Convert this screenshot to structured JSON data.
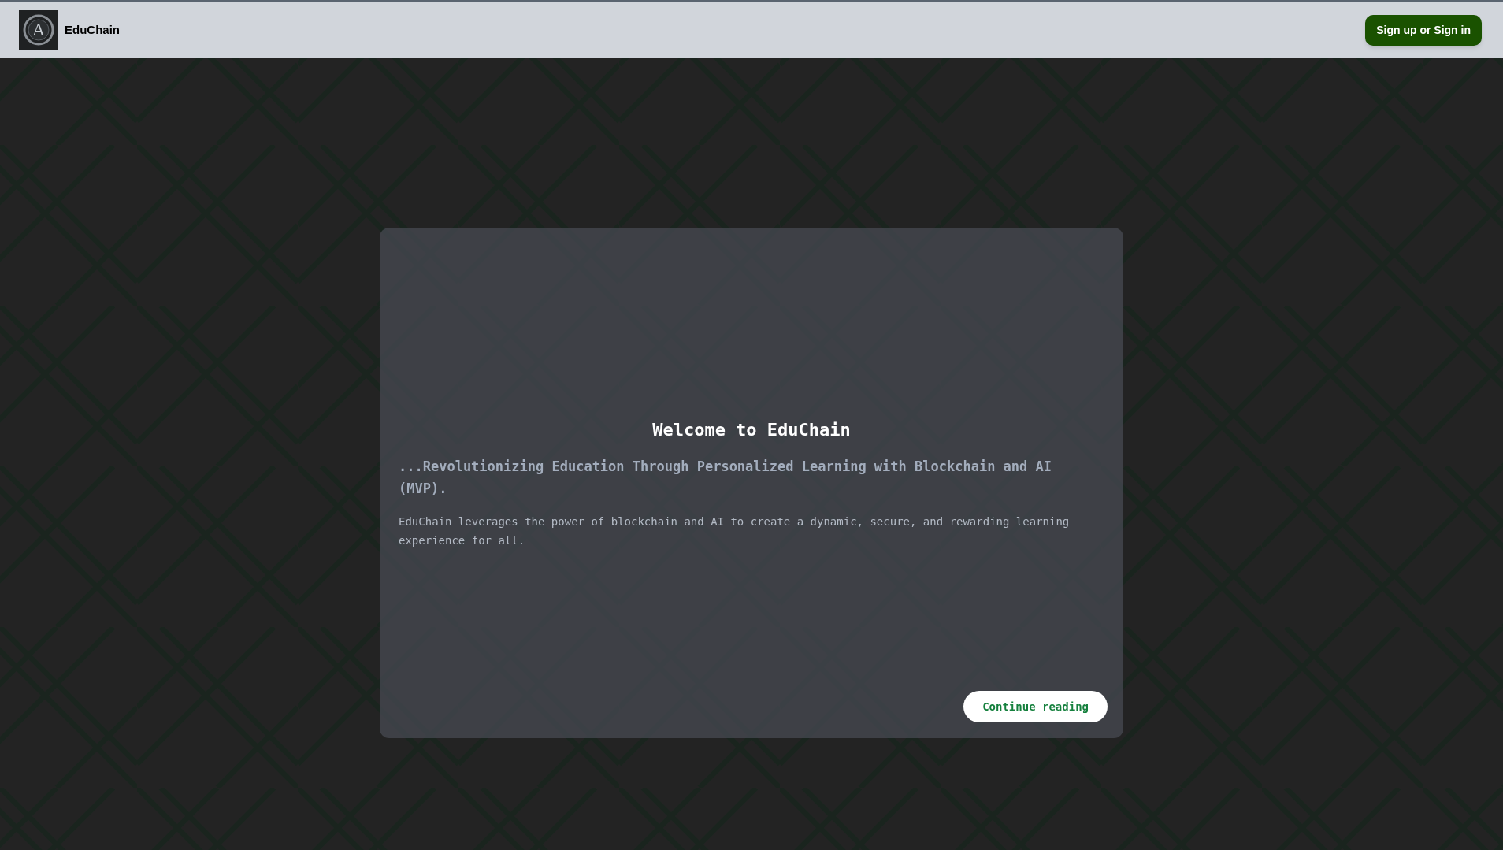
{
  "header": {
    "logo_mark": "A",
    "brand": "EduChain",
    "auth_button": "Sign up or Sign in"
  },
  "hero": {
    "title": "Welcome to EduChain",
    "subtitle": "...Revolutionizing Education Through Personalized Learning with Blockchain and AI (MVP).",
    "description": "EduChain leverages the power of blockchain and AI to create a dynamic, secure, and rewarding learning experience for all.",
    "button": "Continue reading"
  }
}
